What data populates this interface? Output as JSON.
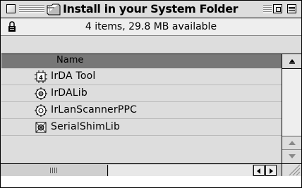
{
  "window": {
    "title": "Install in your System Folder",
    "info": "4 items, 29.8 MB available"
  },
  "list": {
    "column_header": "Name",
    "items": [
      {
        "name": "IrDA Tool",
        "icon": "irda-tool-icon"
      },
      {
        "name": "IrDALib",
        "icon": "shared-library-icon"
      },
      {
        "name": "IrLanScannerPPC",
        "icon": "shared-library-icon"
      },
      {
        "name": "SerialShimLib",
        "icon": "shared-library-icon"
      }
    ]
  },
  "colors": {
    "window_bg": "#dddddd",
    "header_bg": "#777777",
    "info_bg": "#eeeeee"
  }
}
